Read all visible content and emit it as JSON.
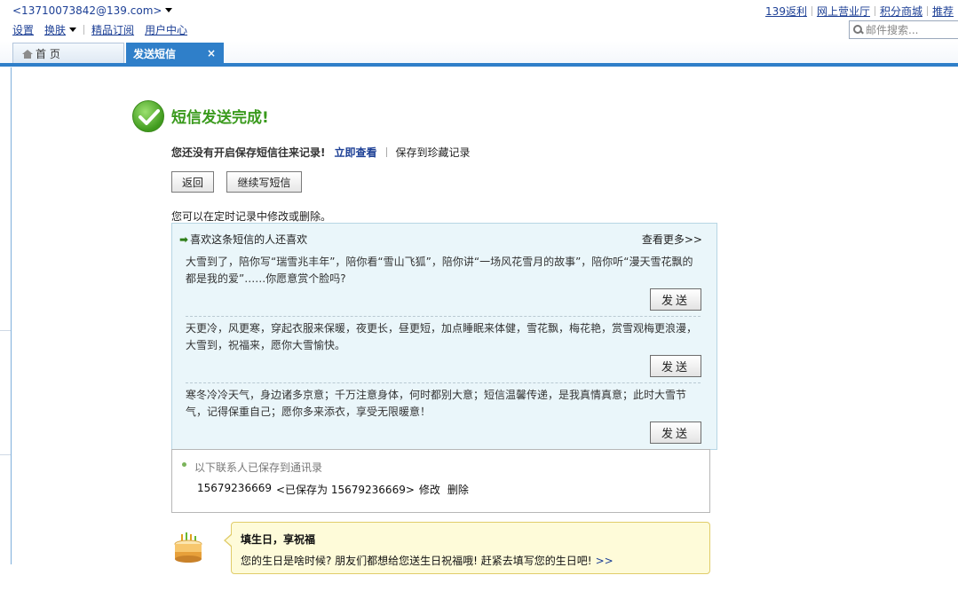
{
  "header": {
    "account": "<13710073842@139.com>",
    "links": {
      "settings": "设置",
      "skin": "换肤",
      "subscribe": "精品订阅",
      "user_center": "用户中心"
    },
    "right_links": [
      "139返利",
      "网上营业厅",
      "积分商城",
      "推荐"
    ],
    "search_placeholder": "邮件搜索..."
  },
  "tabs": {
    "home": "首 页",
    "active": "发送短信",
    "close": "×"
  },
  "result": {
    "title": "短信发送完成!",
    "notice": "您还没有开启保存短信往来记录!",
    "view_now": "立即查看",
    "save_fav": "保存到珍藏记录",
    "back_button": "返回",
    "continue_button": "继续写短信",
    "schedule_note": "您可以在定时记录中修改或删除。"
  },
  "recommend": {
    "title": "喜欢这条短信的人还喜欢",
    "more": "查看更多>>",
    "items": [
      {
        "text": "大雪到了，陪你写“瑞雪兆丰年”，陪你看“雪山飞狐”，陪你讲“一场风花雪月的故事”，陪你听“漫天雪花飘的都是我的爱”……你愿意赏个脸吗?",
        "send": "发送"
      },
      {
        "text": "天更冷，风更寒，穿起衣服来保暖，夜更长，昼更短，加点睡眠来体健，雪花飘，梅花艳，赏雪观梅更浪漫，大雪到，祝福来，愿你大雪愉快。",
        "send": "发送"
      },
      {
        "text": "寒冬冷冷天气，身边诸多京意；千万注意身体，何时都别大意；短信温馨传递，是我真情真意；此时大雪节气，记得保重自己；愿你多来添衣，享受无限暖意！",
        "send": "发送"
      }
    ]
  },
  "saved_contacts": {
    "title": "以下联系人已保存到通讯录",
    "number": "15679236669",
    "saved_as": "<已保存为 15679236669>",
    "edit": "修改",
    "delete": "删除"
  },
  "birthday": {
    "title": "填生日，享祝福",
    "text": "您的生日是啥时候? 朋友们都想给您送生日祝福哦! 赶紧去填写您的生日吧!",
    "link": ">>"
  },
  "colors": {
    "accent": "#2f7fc9",
    "success": "#3a9a1d",
    "panel_bg": "#eaf6fa",
    "tip_bg": "#fefbd9"
  }
}
